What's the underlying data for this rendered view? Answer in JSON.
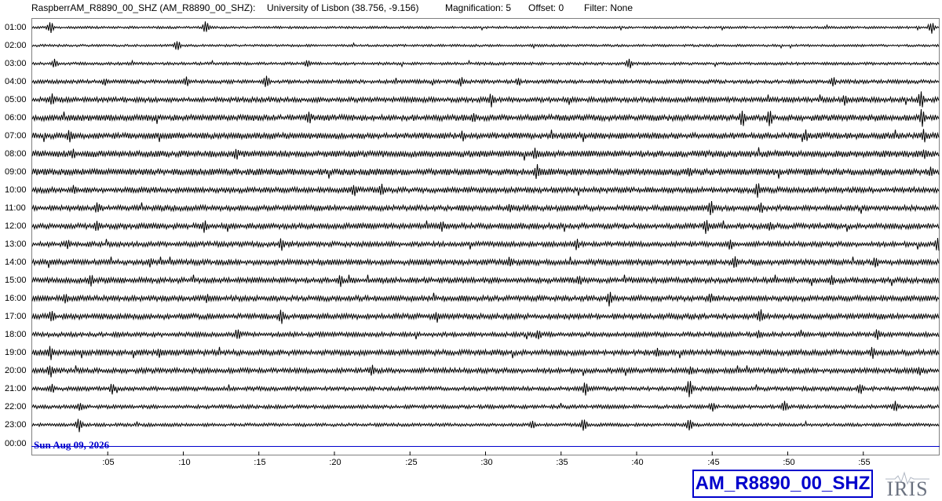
{
  "header": {
    "station_full": "RaspberrAM_R8890_00_SHZ (AM_R8890_00_SHZ):",
    "location": "University of Lisbon (38.756, -9.156)",
    "magnification": "Magnification: 5",
    "offset": "Offset: 0",
    "filter": "Filter: None"
  },
  "row_labels": [
    "01:00",
    "02:00",
    "03:00",
    "04:00",
    "05:00",
    "06:00",
    "07:00",
    "08:00",
    "09:00",
    "10:00",
    "11:00",
    "12:00",
    "13:00",
    "14:00",
    "15:00",
    "16:00",
    "17:00",
    "18:00",
    "19:00",
    "20:00",
    "21:00",
    "22:00",
    "23:00",
    "00:00"
  ],
  "x_ticks": [
    ":05",
    ":10",
    ":15",
    ":20",
    ":25",
    ":30",
    ":35",
    ":40",
    ":45",
    ":50",
    ":55"
  ],
  "date_label": "Sun Aug 09, 2026",
  "station_badge": "AM_R8890_00_SHZ",
  "logo": {
    "name": "iris-logo",
    "text": "IRIS"
  },
  "colors": {
    "trace": "#000000",
    "accent": "#0000cc",
    "frame": "#808080"
  },
  "chart_data": {
    "type": "line",
    "description_units": "minutes past the hour",
    "x_range": [
      0,
      60
    ],
    "rows": 24,
    "traces": [
      {
        "hour": "01:00",
        "amplitude": 1,
        "events": [
          [
            1.2,
            9
          ],
          [
            11.5,
            10
          ],
          [
            59.5,
            9
          ]
        ]
      },
      {
        "hour": "02:00",
        "amplitude": 1,
        "events": [
          [
            9.6,
            8
          ]
        ]
      },
      {
        "hour": "03:00",
        "amplitude": 1.2,
        "events": [
          [
            1.5,
            7
          ],
          [
            18.2,
            6
          ],
          [
            39.5,
            8
          ]
        ]
      },
      {
        "hour": "04:00",
        "amplitude": 1.6,
        "events": [
          [
            4.8,
            6
          ],
          [
            10.2,
            8
          ],
          [
            15.5,
            9
          ],
          [
            28.4,
            7
          ],
          [
            32.2,
            7
          ],
          [
            53,
            7
          ]
        ]
      },
      {
        "hour": "05:00",
        "amplitude": 2.2,
        "events": [
          [
            1.3,
            9
          ],
          [
            30.4,
            10
          ],
          [
            53.8,
            9
          ],
          [
            58.8,
            14
          ]
        ]
      },
      {
        "hour": "06:00",
        "amplitude": 2.6,
        "events": [
          [
            18.3,
            10
          ],
          [
            29.2,
            9
          ],
          [
            47,
            13
          ],
          [
            48.8,
            13
          ],
          [
            58.9,
            14
          ]
        ]
      },
      {
        "hour": "07:00",
        "amplitude": 2.6,
        "events": [
          [
            2.5,
            10
          ],
          [
            28.5,
            8
          ],
          [
            51.2,
            9
          ],
          [
            59,
            11
          ]
        ]
      },
      {
        "hour": "08:00",
        "amplitude": 2.8,
        "events": [
          [
            2.7,
            8
          ],
          [
            13.5,
            9
          ],
          [
            33.3,
            10
          ],
          [
            59,
            8
          ]
        ]
      },
      {
        "hour": "09:00",
        "amplitude": 2.8,
        "events": [
          [
            33.4,
            12
          ],
          [
            43.5,
            9
          ],
          [
            59.5,
            8
          ]
        ]
      },
      {
        "hour": "10:00",
        "amplitude": 2.4,
        "events": [
          [
            2.8,
            8
          ],
          [
            21.3,
            11
          ],
          [
            23.1,
            10
          ],
          [
            48,
            11
          ]
        ]
      },
      {
        "hour": "11:00",
        "amplitude": 2.4,
        "events": [
          [
            4.3,
            9
          ],
          [
            31.6,
            9
          ],
          [
            44.9,
            14
          ],
          [
            48.2,
            10
          ]
        ]
      },
      {
        "hour": "12:00",
        "amplitude": 2.4,
        "events": [
          [
            4.3,
            9
          ],
          [
            11.4,
            10
          ],
          [
            27.1,
            8
          ],
          [
            44.6,
            11
          ],
          [
            48.8,
            8
          ]
        ]
      },
      {
        "hour": "13:00",
        "amplitude": 2.2,
        "events": [
          [
            2.3,
            8
          ],
          [
            16.5,
            9
          ],
          [
            36,
            9
          ],
          [
            46.2,
            9
          ],
          [
            59.9,
            12
          ]
        ]
      },
      {
        "hour": "14:00",
        "amplitude": 2.4,
        "events": [
          [
            7.8,
            7
          ],
          [
            31.6,
            8
          ],
          [
            46.5,
            9
          ],
          [
            55.8,
            9
          ]
        ]
      },
      {
        "hour": "15:00",
        "amplitude": 2.4,
        "events": [
          [
            3.9,
            9
          ],
          [
            20.4,
            9
          ],
          [
            36.2,
            8
          ],
          [
            52.9,
            8
          ]
        ]
      },
      {
        "hour": "16:00",
        "amplitude": 2.4,
        "events": [
          [
            2.2,
            10
          ],
          [
            11.6,
            8
          ],
          [
            38.2,
            11
          ],
          [
            44.9,
            8
          ]
        ]
      },
      {
        "hour": "17:00",
        "amplitude": 2.4,
        "events": [
          [
            1.3,
            10
          ],
          [
            16.5,
            11
          ],
          [
            26.8,
            8
          ],
          [
            48.2,
            11
          ]
        ]
      },
      {
        "hour": "18:00",
        "amplitude": 2,
        "events": [
          [
            13.6,
            9
          ],
          [
            33.5,
            9
          ],
          [
            48.1,
            8
          ],
          [
            55.9,
            8
          ]
        ]
      },
      {
        "hour": "19:00",
        "amplitude": 2.4,
        "events": [
          [
            1.2,
            11
          ],
          [
            8.4,
            8
          ],
          [
            41.4,
            8
          ],
          [
            55.6,
            9
          ]
        ]
      },
      {
        "hour": "20:00",
        "amplitude": 2.2,
        "events": [
          [
            1.2,
            11
          ],
          [
            22.5,
            8
          ],
          [
            43.6,
            8
          ],
          [
            58.7,
            8
          ]
        ]
      },
      {
        "hour": "21:00",
        "amplitude": 1.8,
        "events": [
          [
            1.3,
            7
          ],
          [
            5.3,
            8
          ],
          [
            36.6,
            10
          ],
          [
            43.5,
            14
          ],
          [
            54.8,
            9
          ]
        ]
      },
      {
        "hour": "22:00",
        "amplitude": 1.6,
        "events": [
          [
            3.2,
            8
          ],
          [
            45,
            8
          ],
          [
            49.8,
            9
          ],
          [
            57.1,
            8
          ]
        ]
      },
      {
        "hour": "23:00",
        "amplitude": 1.4,
        "events": [
          [
            3.1,
            11
          ],
          [
            33.1,
            7
          ],
          [
            36.5,
            10
          ],
          [
            43.5,
            10
          ]
        ]
      },
      {
        "hour": "00:00",
        "amplitude": 0,
        "events": []
      }
    ]
  }
}
